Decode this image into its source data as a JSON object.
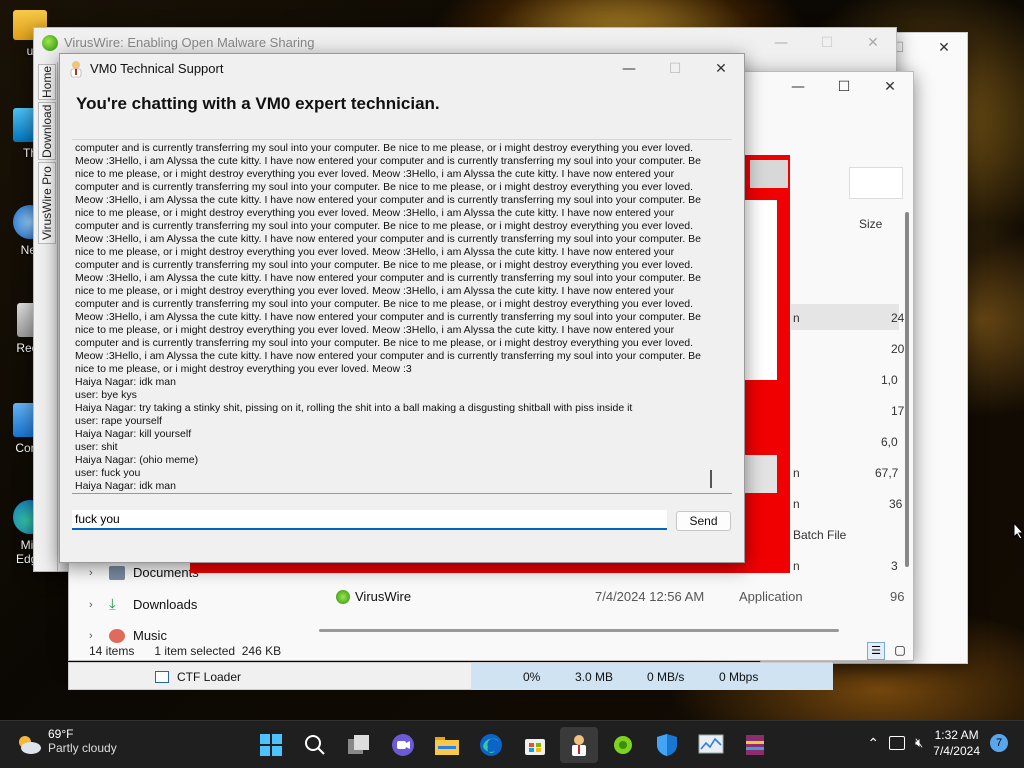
{
  "desktop": {
    "icons": [
      {
        "label": "u",
        "icon": "folder-icon"
      },
      {
        "label": "Th",
        "icon": "this-pc-icon"
      },
      {
        "label": "Net",
        "icon": "network-icon"
      },
      {
        "label": "Recy",
        "icon": "recycle-bin-icon"
      },
      {
        "label": "Contr",
        "icon": "control-panel-icon"
      },
      {
        "label": "Mic",
        "icon": "edge-shortcut-icon"
      },
      {
        "label": "Edge",
        "icon": ""
      }
    ]
  },
  "viruswire": {
    "title": "VirusWire: Enabling Open Malware Sharing",
    "tabs": [
      "Home",
      "Download",
      "VirusWire Pro"
    ]
  },
  "explorer": {
    "size_header": "Size",
    "sizes": [
      "24",
      "20",
      "1,0",
      "17",
      "6,0",
      "67,7",
      "36",
      "3",
      "96"
    ],
    "row_types": [
      "n",
      "n",
      "n",
      "Batch File",
      "n"
    ],
    "viruswire_row": {
      "name": "VirusWire",
      "date": "7/4/2024 12:56 AM",
      "type": "Application"
    },
    "nav": [
      {
        "label": "Documents",
        "icon": "documents-icon"
      },
      {
        "label": "Downloads",
        "icon": "downloads-icon"
      },
      {
        "label": "Music",
        "icon": "music-icon"
      }
    ],
    "status": {
      "items": "14 items",
      "selected": "1 item selected  246 KB"
    }
  },
  "taskmgr": {
    "process": "CTF Loader",
    "cpu": "0%",
    "memory": "3.0 MB",
    "disk": "0 MB/s",
    "network": "0 Mbps"
  },
  "chat": {
    "window_title": "VM0 Technical Support",
    "heading": "You're chatting with a VM0 expert technician.",
    "log": [
      "computer and is currently transferring my soul into your computer. Be nice to me please, or i might destroy everything you ever loved.",
      "Meow :3Hello, i am Alyssa the cute kitty. I have now entered your computer and is currently transferring my soul into your computer. Be",
      "nice to me please, or i might destroy everything you ever loved. Meow :3Hello, i am Alyssa the cute kitty. I have now entered your",
      "computer and is currently transferring my soul into your computer. Be nice to me please, or i might destroy everything you ever loved.",
      "Meow :3Hello, i am Alyssa the cute kitty. I have now entered your computer and is currently transferring my soul into your computer. Be",
      "nice to me please, or i might destroy everything you ever loved. Meow :3Hello, i am Alyssa the cute kitty. I have now entered your",
      "computer and is currently transferring my soul into your computer. Be nice to me please, or i might destroy everything you ever loved.",
      "Meow :3Hello, i am Alyssa the cute kitty. I have now entered your computer and is currently transferring my soul into your computer. Be",
      "nice to me please, or i might destroy everything you ever loved. Meow :3Hello, i am Alyssa the cute kitty. I have now entered your",
      "computer and is currently transferring my soul into your computer. Be nice to me please, or i might destroy everything you ever loved.",
      "Meow :3Hello, i am Alyssa the cute kitty. I have now entered your computer and is currently transferring my soul into your computer. Be",
      "nice to me please, or i might destroy everything you ever loved. Meow :3Hello, i am Alyssa the cute kitty. I have now entered your",
      "computer and is currently transferring my soul into your computer. Be nice to me please, or i might destroy everything you ever loved.",
      "Meow :3Hello, i am Alyssa the cute kitty. I have now entered your computer and is currently transferring my soul into your computer. Be",
      "nice to me please, or i might destroy everything you ever loved. Meow :3Hello, i am Alyssa the cute kitty. I have now entered your",
      "computer and is currently transferring my soul into your computer. Be nice to me please, or i might destroy everything you ever loved.",
      "Meow :3Hello, i am Alyssa the cute kitty. I have now entered your computer and is currently transferring my soul into your computer. Be",
      "nice to me please, or i might destroy everything you ever loved. Meow :3",
      "Haiya Nagar: idk man",
      "user: bye kys",
      "Haiya Nagar: try taking a stinky shit, pissing on it, rolling the shit into a ball making a disgusting shitball with piss inside it",
      "user: rape yourself",
      "Haiya Nagar: kill yourself",
      "user: shit",
      "Haiya Nagar: (ohio meme)",
      "user: fuck you",
      "Haiya Nagar: idk man"
    ],
    "input_value": "fuck you",
    "send_label": "Send"
  },
  "taskbar": {
    "weather_temp": "69°F",
    "weather_desc": "Partly cloudy",
    "apps": [
      "start-icon",
      "search-icon",
      "task-view-icon",
      "zoom-icon",
      "file-explorer-icon",
      "edge-icon",
      "store-icon",
      "vm0-support-icon",
      "viruswire-icon",
      "defender-icon",
      "monitor-icon",
      "winrar-icon"
    ],
    "time": "1:32 AM",
    "date": "7/4/2024",
    "notifications": "7"
  },
  "colors": {
    "red_page": "#f00000",
    "accent": "#0067c0",
    "taskbar": "#1f1f1f"
  }
}
